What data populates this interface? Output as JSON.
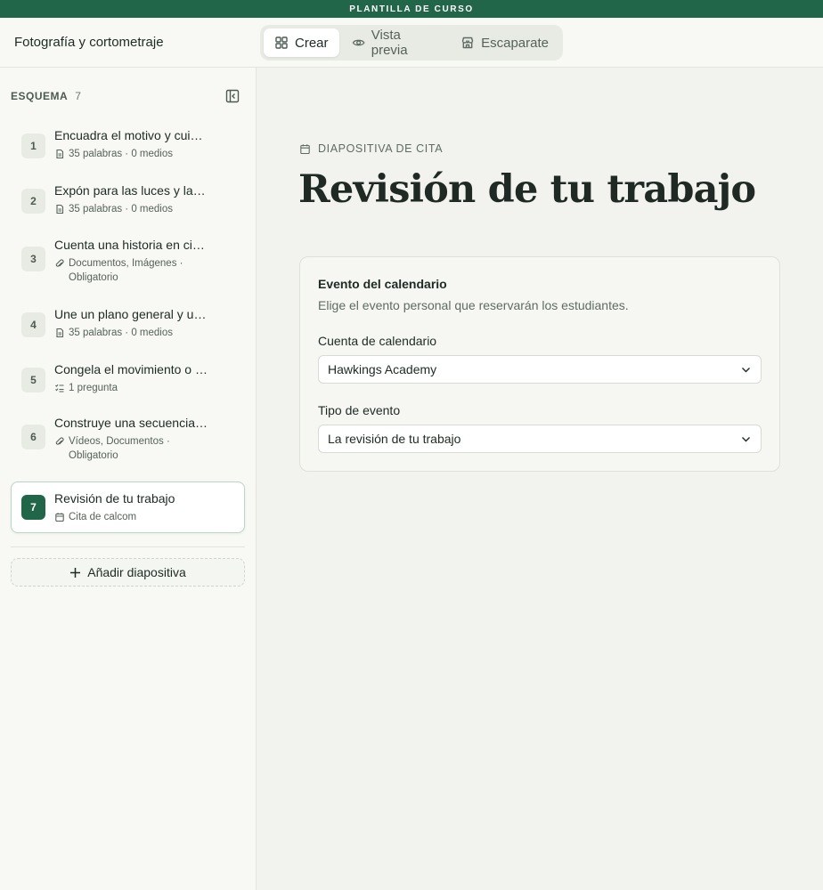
{
  "banner": {
    "label": "PLANTILLA DE CURSO"
  },
  "header": {
    "course_title": "Fotografía y cortometraje",
    "modes": [
      {
        "label": "Crear",
        "icon": "grid-icon",
        "active": true
      },
      {
        "label": "Vista previa",
        "icon": "eye-icon",
        "active": false
      },
      {
        "label": "Escaparate",
        "icon": "storefront-icon",
        "active": false
      }
    ]
  },
  "sidebar": {
    "outline_label": "ESQUEMA",
    "outline_count": "7",
    "slides": [
      {
        "number": "1",
        "title": "Encuadra el motivo y cuida la composición",
        "meta_icon": "document-icon",
        "meta": "35 palabras · 0 medios"
      },
      {
        "number": "2",
        "title": "Expón para las luces y las sombras",
        "meta_icon": "document-icon",
        "meta": "35 palabras · 0 medios"
      },
      {
        "number": "3",
        "title": "Cuenta una historia en cinco fotos",
        "meta_icon": "paperclip-icon",
        "meta": "Documentos, Imágenes · Obligatorio"
      },
      {
        "number": "4",
        "title": "Une un plano general y un primer plano",
        "meta_icon": "document-icon",
        "meta": "35 palabras · 0 medios"
      },
      {
        "number": "5",
        "title": "Congela el movimiento o captura el desenfoque",
        "meta_icon": "checklist-icon",
        "meta": "1 pregunta"
      },
      {
        "number": "6",
        "title": "Construye una secuencia de planos",
        "meta_icon": "paperclip-icon",
        "meta": "Vídeos, Documentos · Obligatorio"
      },
      {
        "number": "7",
        "title": "Revisión de tu trabajo",
        "meta_icon": "calendar-icon",
        "meta": "Cita de calcom",
        "active": true
      }
    ],
    "add_slide_label": "Añadir diapositiva"
  },
  "main": {
    "slide_kind": "DIAPOSITIVA DE CITA",
    "title": "Revisión de tu trabajo",
    "card": {
      "title": "Evento del calendario",
      "subtitle": "Elige el evento personal que reservarán los estudiantes.",
      "account_label": "Cuenta de calendario",
      "account_value": "Hawkings Academy",
      "event_type_label": "Tipo de evento",
      "event_type_value": "La revisión de tu trabajo"
    }
  },
  "colors": {
    "brand_green": "#22664a",
    "background": "#f2f3ee",
    "sidebar": "#f8f9f5",
    "text": "#1f2a24",
    "muted_text": "#5f6b64"
  }
}
